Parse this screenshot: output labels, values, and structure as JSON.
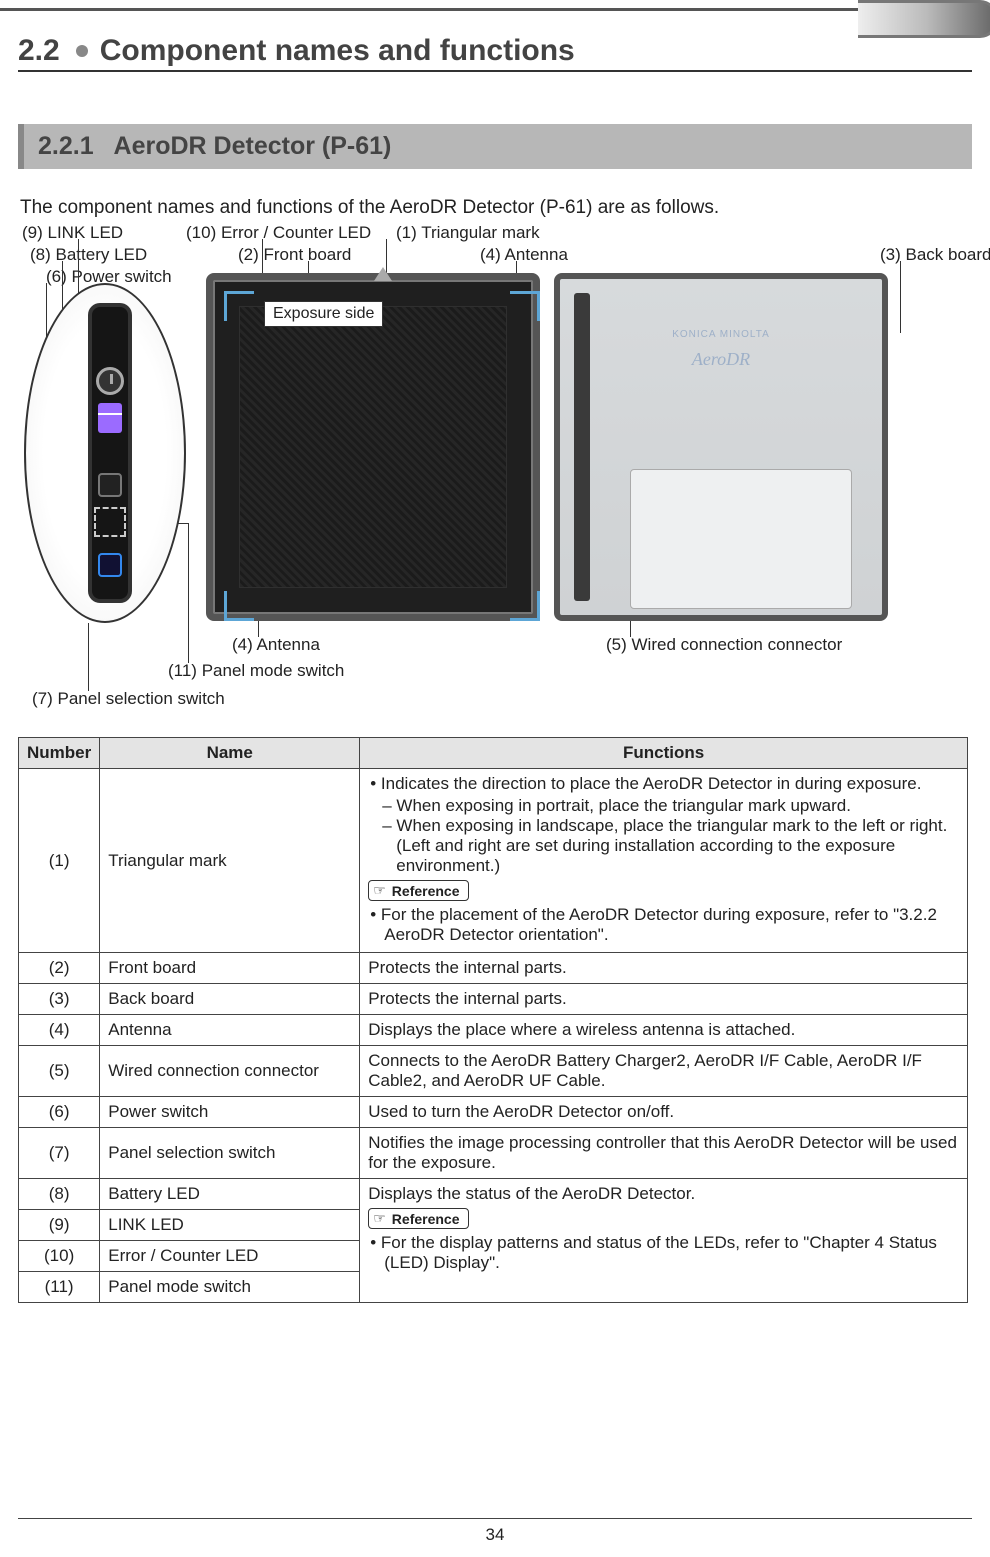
{
  "section": {
    "number": "2.2",
    "title": "Component names and functions"
  },
  "subsection": {
    "number": "2.2.1",
    "title": "AeroDR Detector (P-61)"
  },
  "intro": "The component names and functions of the AeroDR Detector (P-61) are as follows.",
  "diagram": {
    "exposure_side": "Exposure side",
    "brand_small": "KONICA MINOLTA",
    "brand": "AeroDR",
    "labels": {
      "l1": "(1) Triangular mark",
      "l2": "(2) Front board",
      "l3": "(3) Back board",
      "l4a": "(4) Antenna",
      "l4b": "(4) Antenna",
      "l5": "(5) Wired connection connector",
      "l6": "(6) Power switch",
      "l7": "(7) Panel selection switch",
      "l8": "(8) Battery LED",
      "l9": "(9) LINK LED",
      "l10": "(10) Error / Counter LED",
      "l11": "(11) Panel mode switch"
    }
  },
  "table": {
    "headers": {
      "num": "Number",
      "name": "Name",
      "func": "Functions"
    },
    "reference_label": "Reference",
    "rows": {
      "r1": {
        "num": "(1)",
        "name": "Triangular mark",
        "b1": "Indicates the direction to place the AeroDR Detector in during exposure.",
        "s1": "When exposing in portrait, place the triangular mark upward.",
        "s2": "When exposing in landscape, place the triangular mark to the left or right. (Left and right are set during installation according to the exposure environment.)",
        "ref": "For the placement of the AeroDR Detector during exposure, refer to \"3.2.2 AeroDR Detector orientation\"."
      },
      "r2": {
        "num": "(2)",
        "name": "Front board",
        "func": "Protects the internal parts."
      },
      "r3": {
        "num": "(3)",
        "name": "Back board",
        "func": "Protects the internal parts."
      },
      "r4": {
        "num": "(4)",
        "name": "Antenna",
        "func": "Displays the place where a wireless antenna is attached."
      },
      "r5": {
        "num": "(5)",
        "name": "Wired connection connector",
        "func": "Connects to the AeroDR Battery Charger2, AeroDR I/F Cable, AeroDR I/F Cable2, and AeroDR UF Cable."
      },
      "r6": {
        "num": "(6)",
        "name": "Power switch",
        "func": "Used to turn the AeroDR Detector on/off."
      },
      "r7": {
        "num": "(7)",
        "name": "Panel selection switch",
        "func": "Notifies the image processing controller that this AeroDR Detector will be used for the exposure."
      },
      "r8": {
        "num": "(8)",
        "name": "Battery LED",
        "func_intro": "Displays the status of the AeroDR Detector.",
        "ref": "For the display patterns and status of the LEDs, refer to \"Chapter 4 Status (LED) Display\"."
      },
      "r9": {
        "num": "(9)",
        "name": "LINK LED"
      },
      "r10": {
        "num": "(10)",
        "name": "Error / Counter LED"
      },
      "r11": {
        "num": "(11)",
        "name": "Panel mode switch"
      }
    }
  },
  "page_number": "34"
}
